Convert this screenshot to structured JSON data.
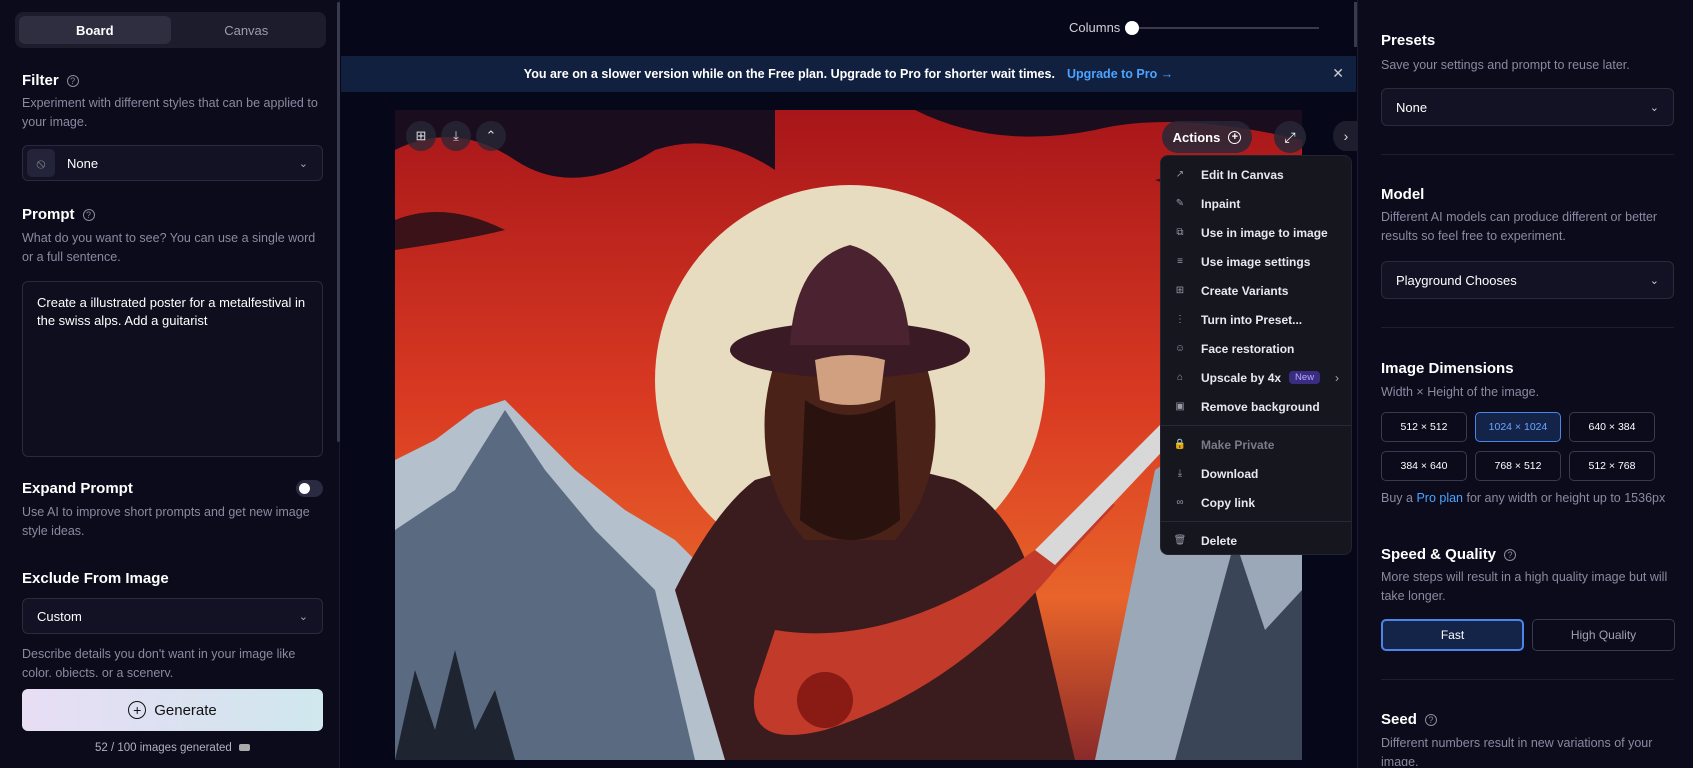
{
  "left": {
    "tabs": [
      "Board",
      "Canvas"
    ],
    "filter": {
      "title": "Filter",
      "desc": "Experiment with different styles that can be applied to your image.",
      "value": "None"
    },
    "prompt": {
      "title": "Prompt",
      "desc": "What do you want to see? You can use a single word or a full sentence.",
      "value": "Create a illustrated poster for a metalfestival in the swiss alps. Add a guitarist"
    },
    "expand": {
      "title": "Expand Prompt",
      "desc": "Use AI to improve short prompts and get new image style ideas."
    },
    "exclude": {
      "title": "Exclude From Image",
      "value": "Custom",
      "desc": "Describe details you don't want in your image like color, objects, or a scenery."
    },
    "generate_label": "Generate",
    "count_text": "52 / 100 images generated"
  },
  "center": {
    "columns_label": "Columns",
    "banner_text": "You are on a slower version while on the Free plan. Upgrade to Pro for shorter wait times.",
    "banner_link": "Upgrade to Pro →",
    "actions_label": "Actions",
    "menu": [
      {
        "label": "Edit In Canvas",
        "icon": "↗"
      },
      {
        "label": "Inpaint",
        "icon": "✎"
      },
      {
        "label": "Use in image to image",
        "icon": "⧉"
      },
      {
        "label": "Use image settings",
        "icon": "≡"
      },
      {
        "label": "Create Variants",
        "icon": "⊞"
      },
      {
        "label": "Turn into Preset...",
        "icon": "⋮"
      },
      {
        "label": "Face restoration",
        "icon": "☺"
      },
      {
        "label": "Upscale by 4x",
        "icon": "⌂",
        "badge": "New"
      },
      {
        "label": "Remove background",
        "icon": "▣"
      },
      {
        "label": "Make Private",
        "icon": "🔒"
      },
      {
        "label": "Download",
        "icon": "⤓"
      },
      {
        "label": "Copy link",
        "icon": "∞"
      },
      {
        "label": "Delete",
        "icon": "🗑"
      }
    ]
  },
  "right": {
    "presets": {
      "title": "Presets",
      "desc": "Save your settings and prompt to reuse later.",
      "value": "None"
    },
    "model": {
      "title": "Model",
      "desc": "Different AI models can produce different or better results so feel free to experiment.",
      "value": "Playground Chooses"
    },
    "dimensions": {
      "title": "Image Dimensions",
      "desc": "Width × Height of the image.",
      "options": [
        "512 × 512",
        "1024 × 1024",
        "640 × 384",
        "384 × 640",
        "768 × 512",
        "512 × 768"
      ],
      "selected": "1024 × 1024",
      "pro_prefix": "Buy a",
      "pro_link": "Pro plan",
      "pro_suffix": "for any width or height up to 1536px"
    },
    "speed": {
      "title": "Speed & Quality",
      "desc": "More steps will result in a high quality image but will take longer.",
      "options": [
        "Fast",
        "High Quality"
      ],
      "selected": "Fast"
    },
    "seed": {
      "title": "Seed",
      "desc": "Different numbers result in new variations of your image."
    }
  },
  "colors": {
    "accent": "#4aa4ff",
    "selected_border": "#4a86e8",
    "banner_bg": "#122040"
  }
}
